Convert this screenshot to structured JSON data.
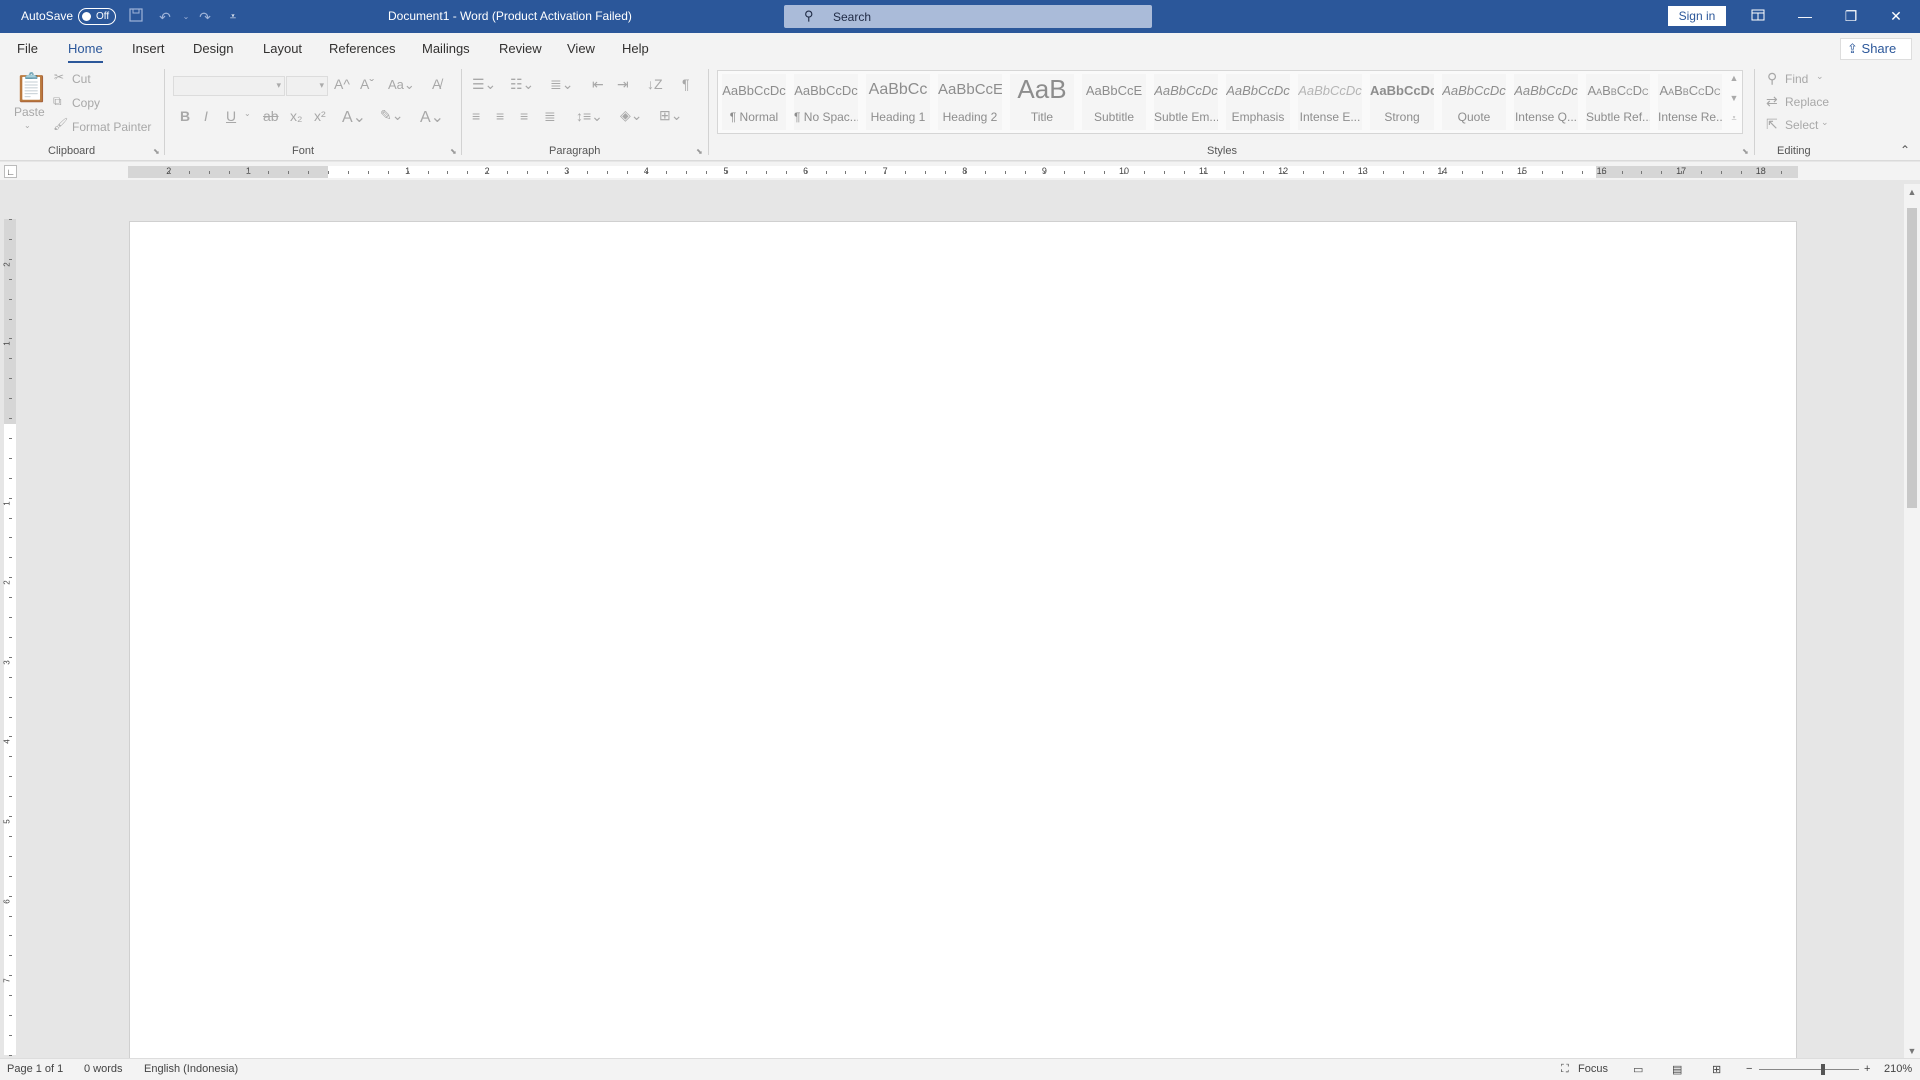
{
  "titlebar": {
    "autosave_label": "AutoSave",
    "autosave_state": "Off",
    "document_title": "Document1  -  Word (Product Activation Failed)",
    "search_placeholder": "Search",
    "signin_label": "Sign in",
    "accent_color": "#2b579a"
  },
  "tabs": [
    {
      "label": "File"
    },
    {
      "label": "Home",
      "active": true
    },
    {
      "label": "Insert"
    },
    {
      "label": "Design"
    },
    {
      "label": "Layout"
    },
    {
      "label": "References"
    },
    {
      "label": "Mailings"
    },
    {
      "label": "Review"
    },
    {
      "label": "View"
    },
    {
      "label": "Help"
    }
  ],
  "share_label": "Share",
  "ribbon": {
    "clipboard": {
      "paste": "Paste",
      "cut": "Cut",
      "copy": "Copy",
      "format_painter": "Format Painter",
      "group_label": "Clipboard"
    },
    "font": {
      "group_label": "Font"
    },
    "paragraph": {
      "group_label": "Paragraph"
    },
    "styles": {
      "group_label": "Styles",
      "items": [
        {
          "sample": "AaBbCcDc",
          "name": "¶ Normal"
        },
        {
          "sample": "AaBbCcDc",
          "name": "¶ No Spac..."
        },
        {
          "sample": "AaBbCc",
          "name": "Heading 1"
        },
        {
          "sample": "AaBbCcE",
          "name": "Heading 2"
        },
        {
          "sample": "AaB",
          "name": "Title"
        },
        {
          "sample": "AaBbCcE",
          "name": "Subtitle"
        },
        {
          "sample": "AaBbCcDc",
          "name": "Subtle Em..."
        },
        {
          "sample": "AaBbCcDc",
          "name": "Emphasis"
        },
        {
          "sample": "AaBbCcDc",
          "name": "Intense E..."
        },
        {
          "sample": "AaBbCcDc",
          "name": "Strong"
        },
        {
          "sample": "AaBbCcDc",
          "name": "Quote"
        },
        {
          "sample": "AaBbCcDc",
          "name": "Intense Q..."
        },
        {
          "sample": "AaBbCcDc",
          "name": "Subtle Ref..."
        },
        {
          "sample": "AaBbCcDc",
          "name": "Intense Re..."
        }
      ]
    },
    "editing": {
      "find": "Find",
      "replace": "Replace",
      "select": "Select",
      "group_label": "Editing"
    }
  },
  "ruler": {
    "horizontal_numbers": [
      "2",
      "1",
      "1",
      "2",
      "3",
      "4",
      "5",
      "6",
      "7",
      "8",
      "9",
      "10",
      "11",
      "12",
      "13",
      "14",
      "15",
      "16",
      "17",
      "18"
    ],
    "vertical_numbers": [
      "2",
      "1",
      "1",
      "2",
      "3",
      "4",
      "5",
      "6",
      "7"
    ]
  },
  "statusbar": {
    "page": "Page 1 of 1",
    "words": "0 words",
    "language": "English (Indonesia)",
    "focus": "Focus",
    "zoom": "210%"
  }
}
